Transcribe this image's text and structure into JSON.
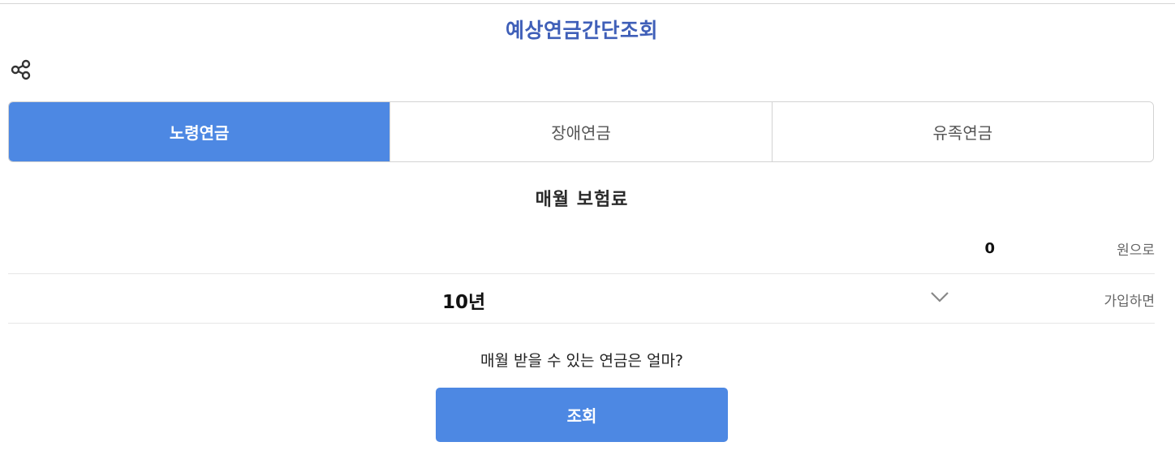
{
  "page": {
    "title": "예상연금간단조회"
  },
  "share": {
    "icon": "share-icon"
  },
  "tabs": [
    {
      "label": "노령연금",
      "active": true
    },
    {
      "label": "장애연금",
      "active": false
    },
    {
      "label": "유족연금",
      "active": false
    }
  ],
  "form": {
    "section_title": "매월 보험료",
    "amount": {
      "value": "0",
      "unit": "원으로"
    },
    "period": {
      "selected": "10년",
      "unit": "가입하면",
      "icon": "chevron-down-icon"
    },
    "question": "매월 받을 수 있는 연금은 얼마?",
    "submit_label": "조회"
  },
  "colors": {
    "accent": "#4d88e3",
    "title": "#3f5fb8"
  }
}
